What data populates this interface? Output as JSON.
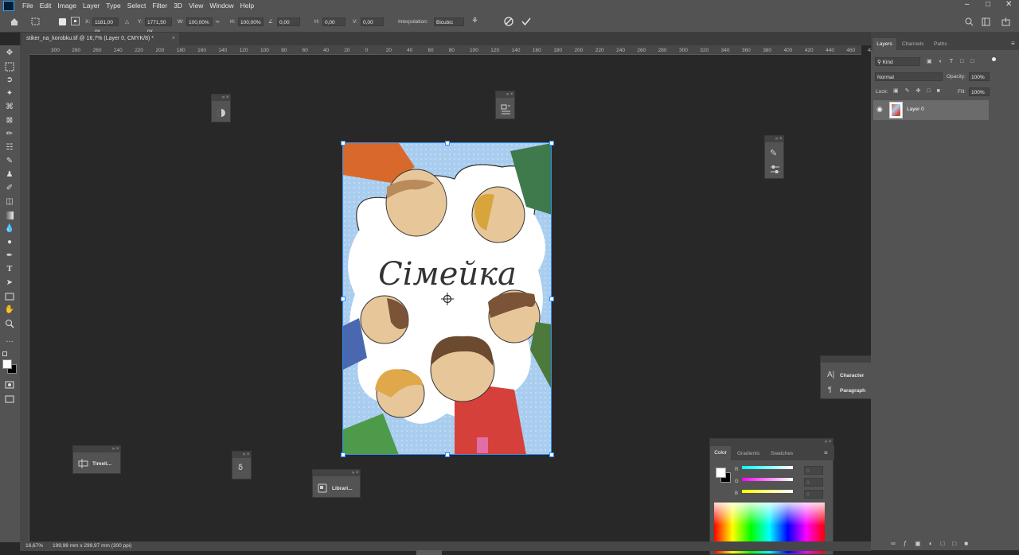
{
  "menubar": {
    "items": [
      "File",
      "Edit",
      "Image",
      "Layer",
      "Type",
      "Select",
      "Filter",
      "3D",
      "View",
      "Window",
      "Help"
    ]
  },
  "options": {
    "x_label": "X:",
    "x_value": "1181,00 px",
    "y_label": "Y:",
    "y_value": "1771,50 px",
    "w_label": "W:",
    "w_value": "100,00%",
    "h_label": "H:",
    "h_value": "100,00%",
    "angle_value": "0,00",
    "hskew_label": "H:",
    "hskew_value": "0,00",
    "vskew_label": "V:",
    "vskew_value": "0,00",
    "interp_label": "Interpolation:",
    "interp_value": "Bicubic"
  },
  "document": {
    "tab_title": "stiker_na_korobku.tif @ 16,7% (Layer 0, CMYK/8) *",
    "image_title": "Сімейка"
  },
  "rulers": {
    "h_ticks": [
      "300",
      "280",
      "260",
      "240",
      "220",
      "200",
      "180",
      "160",
      "140",
      "120",
      "100",
      "80",
      "60",
      "40",
      "20",
      "0",
      "20",
      "40",
      "60",
      "80",
      "100",
      "120",
      "140",
      "160",
      "180",
      "200",
      "220",
      "240",
      "260",
      "280",
      "300",
      "320",
      "340",
      "360",
      "380",
      "400",
      "420",
      "440",
      "460",
      "480"
    ]
  },
  "floating": {
    "timeline": "Timeli...",
    "libraries": "Librari...",
    "character": "Character",
    "paragraph": "Paragraph"
  },
  "layers_panel": {
    "tabs": [
      "Layers",
      "Channels",
      "Paths"
    ],
    "kind": "Kind",
    "blend_mode": "Normal",
    "opacity_label": "Opacity:",
    "opacity_value": "100%",
    "lock_label": "Lock:",
    "fill_label": "Fill:",
    "fill_value": "100%",
    "layer_name": "Layer 0"
  },
  "color_panel": {
    "tabs": [
      "Color",
      "Gradients",
      "Swatches"
    ],
    "r_label": "R",
    "g_label": "G",
    "b_label": "B",
    "r_value": "0",
    "g_value": "0",
    "b_value": "0"
  },
  "status": {
    "zoom": "16,67%",
    "doc_info": "199,98 mm x 299,97 mm (300 ppi)"
  }
}
